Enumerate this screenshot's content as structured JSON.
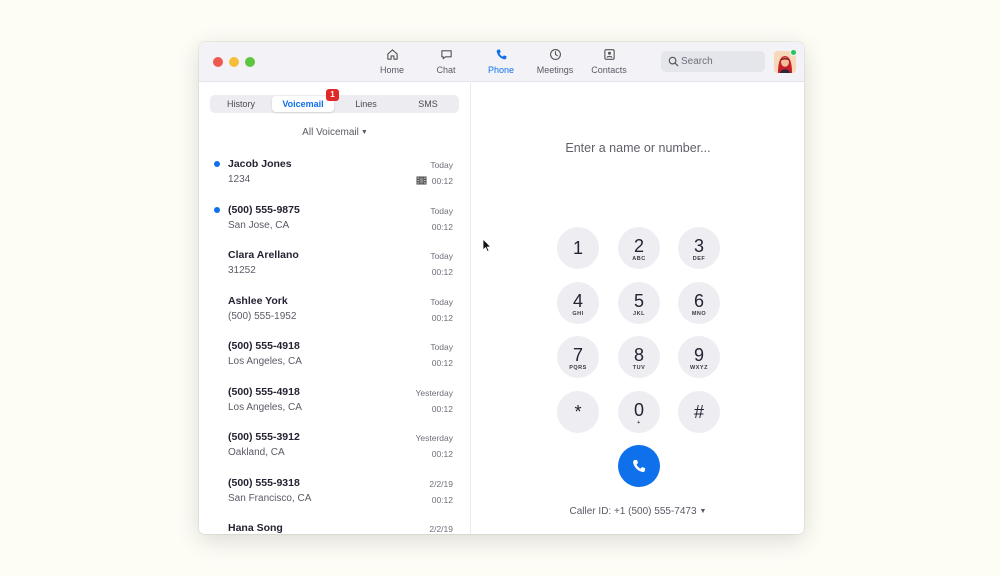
{
  "nav": [
    {
      "id": "home",
      "label": "Home",
      "icon": "home-icon"
    },
    {
      "id": "chat",
      "label": "Chat",
      "icon": "chat-icon"
    },
    {
      "id": "phone",
      "label": "Phone",
      "icon": "phone-icon",
      "active": true
    },
    {
      "id": "meetings",
      "label": "Meetings",
      "icon": "clock-icon"
    },
    {
      "id": "contacts",
      "label": "Contacts",
      "icon": "contacts-icon"
    }
  ],
  "search": {
    "placeholder": "Search"
  },
  "tabs": [
    {
      "label": "History"
    },
    {
      "label": "Voicemail",
      "active": true,
      "badge": "1"
    },
    {
      "label": "Lines"
    },
    {
      "label": "SMS"
    }
  ],
  "filter": {
    "label": "All Voicemail"
  },
  "voicemails": [
    {
      "name": "Jacob Jones",
      "sub": "1234",
      "date": "Today",
      "duration": "00:12",
      "unread": true,
      "video": true
    },
    {
      "name": "(500) 555-9875",
      "sub": "San Jose, CA",
      "date": "Today",
      "duration": "00:12",
      "unread": true
    },
    {
      "name": "Clara Arellano",
      "sub": "31252",
      "date": "Today",
      "duration": "00:12"
    },
    {
      "name": "Ashlee York",
      "sub": "(500) 555-1952",
      "date": "Today",
      "duration": "00:12"
    },
    {
      "name": "(500) 555-4918",
      "sub": "Los Angeles, CA",
      "date": "Today",
      "duration": "00:12"
    },
    {
      "name": "(500) 555-4918",
      "sub": "Los Angeles, CA",
      "date": "Yesterday",
      "duration": "00:12"
    },
    {
      "name": "(500) 555-3912",
      "sub": "Oakland, CA",
      "date": "Yesterday",
      "duration": "00:12"
    },
    {
      "name": "(500) 555-9318",
      "sub": "San Francisco, CA",
      "date": "2/2/19",
      "duration": "00:12"
    },
    {
      "name": "Hana Song",
      "sub": "",
      "date": "2/2/19",
      "duration": ""
    }
  ],
  "dialer": {
    "placeholder": "Enter a name or number...",
    "keys": [
      {
        "digit": "1",
        "letters": ""
      },
      {
        "digit": "2",
        "letters": "ABC"
      },
      {
        "digit": "3",
        "letters": "DEF"
      },
      {
        "digit": "4",
        "letters": "GHI"
      },
      {
        "digit": "5",
        "letters": "JKL"
      },
      {
        "digit": "6",
        "letters": "MNO"
      },
      {
        "digit": "7",
        "letters": "PQRS"
      },
      {
        "digit": "8",
        "letters": "TUV"
      },
      {
        "digit": "9",
        "letters": "WXYZ"
      },
      {
        "digit": "*",
        "letters": ""
      },
      {
        "digit": "0",
        "letters": "+"
      },
      {
        "digit": "#",
        "letters": ""
      }
    ],
    "caller_id": "Caller ID: +1 (500) 555-7473"
  },
  "colors": {
    "accent": "#0e71eb",
    "badge": "#e02828",
    "presence": "#23c55e"
  }
}
